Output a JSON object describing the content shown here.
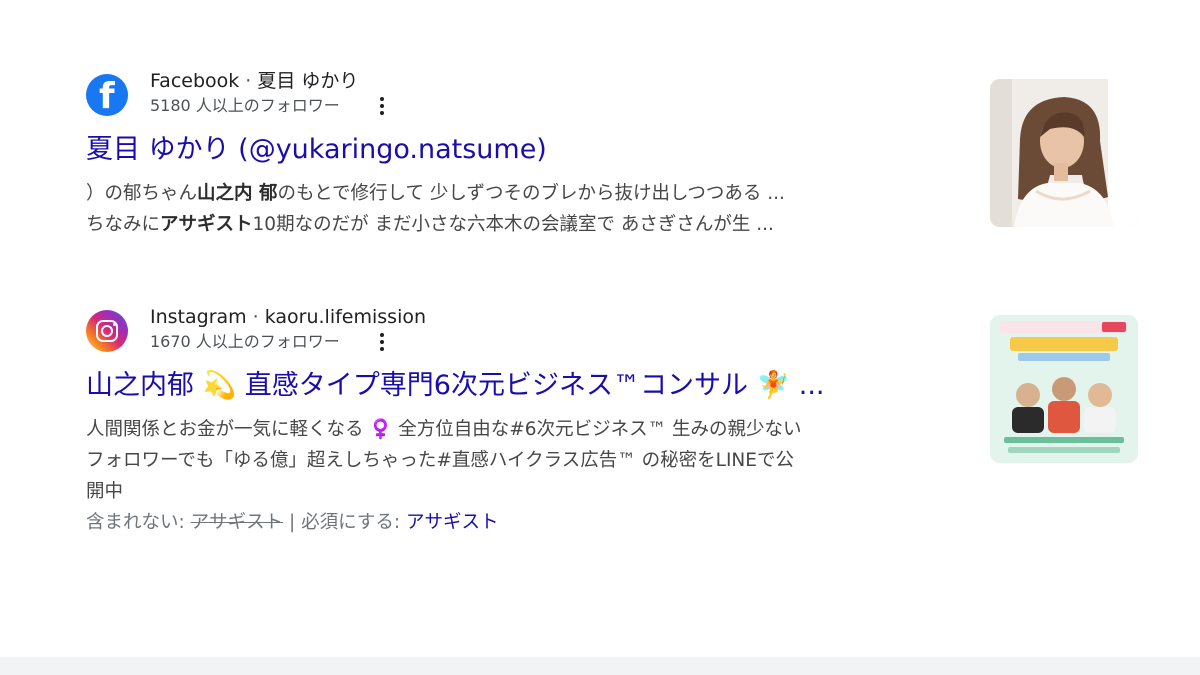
{
  "results": [
    {
      "favicon": "facebook-icon",
      "source": "Facebook",
      "separator": "·",
      "account": "夏目 ゆかり",
      "followers": "5180 人以上のフォロワー",
      "title": "夏目 ゆかり (@yukaringo.natsume)",
      "snippet_line1": [
        {
          "t": "）の郁ちゃん",
          "b": false
        },
        {
          "t": "山之内 郁",
          "b": true
        },
        {
          "t": "のもとで修行して 少しずつそのブレから抜け出しつつある ...",
          "b": false
        }
      ],
      "snippet_line2": [
        {
          "t": "ちなみに",
          "b": false
        },
        {
          "t": "アサギスト",
          "b": true
        },
        {
          "t": "10期なのだが まだ小さな六本木の会議室で あさぎさんが生 ...",
          "b": false
        }
      ],
      "thumbnail": "portrait-photo"
    },
    {
      "favicon": "instagram-icon",
      "source": "Instagram",
      "separator": "·",
      "account": "kaoru.lifemission",
      "followers": "1670 人以上のフォロワー",
      "title": "山之内郁 💫 直感タイプ専門6次元ビジネス™コンサル 🧚 ...",
      "snippet_line1": "人間関係とお金が一気に軽くなる ♀️ 全方位自由な#6次元ビジネス™ 生みの親少ない",
      "snippet_line2": "フォロワーでも「ゆる億」超えしちゃった#直感ハイクラス広告™ の秘密をLINEで公",
      "snippet_line3": "開中",
      "missing_label": "含まれない: ",
      "missing_term": "アサギスト",
      "missing_sep": " | ",
      "must_include_label": "必須にする: ",
      "must_include_term": "アサギスト",
      "thumbnail": "promo-banner-image"
    }
  ],
  "colors": {
    "link": "#1a0dab",
    "facebook": "#1877f2",
    "snippet": "#474747",
    "muted": "#70757a"
  }
}
